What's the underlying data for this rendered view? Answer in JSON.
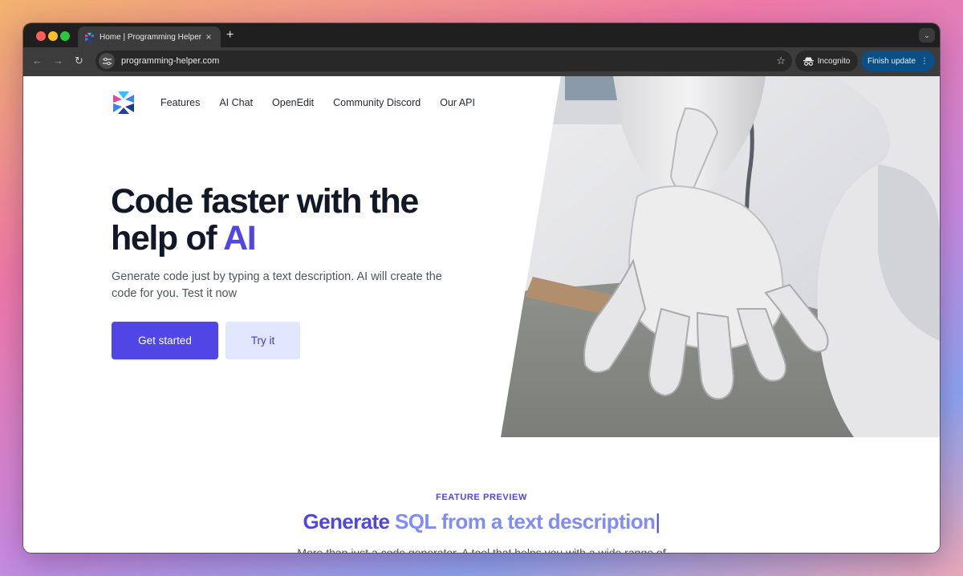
{
  "browser": {
    "tab_title": "Home | Programming Helper",
    "tab_close": "×",
    "new_tab": "+",
    "url": "programming-helper.com",
    "incognito_label": "Incognito",
    "update_label": "Finish update",
    "update_menu": "⋮",
    "back": "←",
    "forward": "→",
    "reload": "↻",
    "bookmark": "☆",
    "tab_menu": "⌄"
  },
  "nav": {
    "items": [
      "Features",
      "AI Chat",
      "OpenEdit",
      "Community Discord",
      "Our API"
    ]
  },
  "hero": {
    "title_main": "Code faster with the help of ",
    "title_accent": "AI",
    "subtitle": "Generate code just by typing a text description. AI will create the code for you. Test it now",
    "primary_button": "Get started",
    "secondary_button": "Try it"
  },
  "feature": {
    "eyebrow": "FEATURE PREVIEW",
    "title_dark": "Generate ",
    "title_light": "SQL from a text description",
    "cursor": "|",
    "description": "More than just a code generator. A tool that helps you with a wide range of"
  },
  "colors": {
    "accent": "#4f46e5",
    "accent_light": "#818cf8",
    "secondary_bg": "#e0e7ff"
  }
}
